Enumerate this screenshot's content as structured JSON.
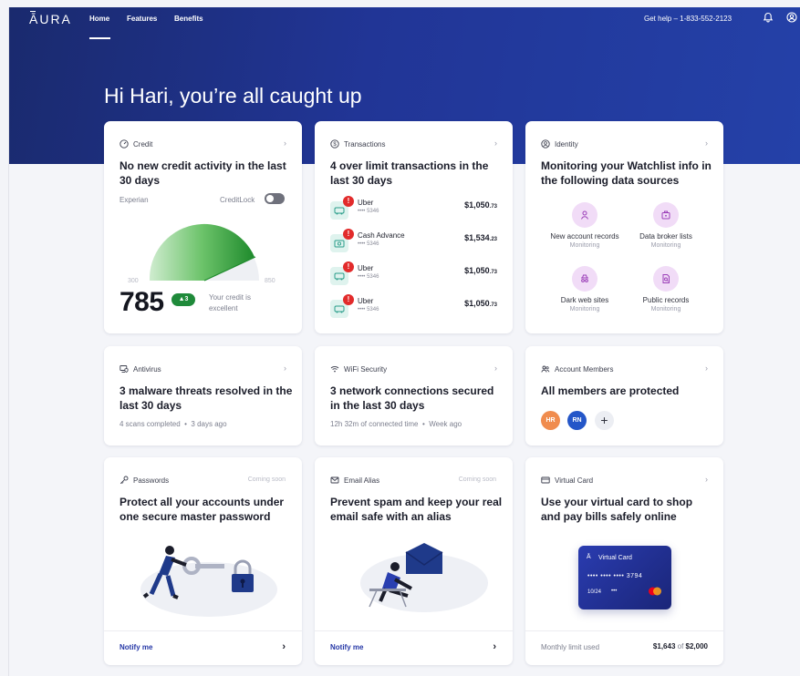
{
  "nav": {
    "logo": "ĀURA",
    "links": [
      "Home",
      "Features",
      "Benefits"
    ],
    "help": "Get help – 1-833-552-2123"
  },
  "greeting": "Hi Hari, you’re all caught up",
  "credit": {
    "label": "Credit",
    "title": "No new credit activity in the last 30 days",
    "bureau": "Experian",
    "lock_label": "CreditLock",
    "lock_on": false,
    "min": "300",
    "max": "850",
    "score": "785",
    "change": "▲3",
    "status": "Your credit is excellent",
    "gauge_fraction": 0.88
  },
  "transactions": {
    "label": "Transactions",
    "title": "4 over limit transactions in the last 30 days",
    "items": [
      {
        "name": "Uber",
        "card": "•••• 5346",
        "amount": "$1,050",
        "cents": ".73"
      },
      {
        "name": "Cash Advance",
        "card": "•••• 5346",
        "amount": "$1,534",
        "cents": ".23"
      },
      {
        "name": "Uber",
        "card": "•••• 5346",
        "amount": "$1,050",
        "cents": ".73"
      },
      {
        "name": "Uber",
        "card": "•••• 5346",
        "amount": "$1,050",
        "cents": ".73"
      }
    ]
  },
  "identity": {
    "label": "Identity",
    "title": "Monitoring your Watchlist info in the following data sources",
    "sources": [
      {
        "name": "New account records",
        "status": "Monitoring"
      },
      {
        "name": "Data broker lists",
        "status": "Monitoring"
      },
      {
        "name": "Dark web sites",
        "status": "Monitoring"
      },
      {
        "name": "Public records",
        "status": "Monitoring"
      }
    ]
  },
  "antivirus": {
    "label": "Antivirus",
    "title": "3 malware threats resolved in the last 30 days",
    "scans": "4 scans completed",
    "when": "3 days ago"
  },
  "wifi": {
    "label": "WiFi Security",
    "title": "3 network connections secured in the last 30 days",
    "time": "12h 32m of connected time",
    "when": "Week ago"
  },
  "members": {
    "label": "Account Members",
    "title": "All members are protected",
    "avatars": [
      "HR",
      "RN"
    ],
    "add": "+"
  },
  "passwords": {
    "label": "Passwords",
    "badge": "Coming soon",
    "title": "Protect all your accounts under one secure master password",
    "cta": "Notify me"
  },
  "email_alias": {
    "label": "Email Alias",
    "badge": "Coming soon",
    "title": "Prevent spam and keep your real email safe with an alias",
    "cta": "Notify me"
  },
  "virtual_card": {
    "label": "Virtual Card",
    "title": "Use your virtual card to shop and pay bills safely online",
    "card_name": "Virtual Card",
    "card_number": "•••• •••• •••• 3794",
    "expiry": "10/24",
    "cvv": "•••",
    "limit_label": "Monthly limit used",
    "used": "$1,643",
    "of": "of",
    "limit": "$2,000"
  },
  "colors": {
    "hero": "#213596",
    "accent": "#2537a6",
    "positive": "#1f8a3a",
    "alert": "#e22b2b"
  }
}
